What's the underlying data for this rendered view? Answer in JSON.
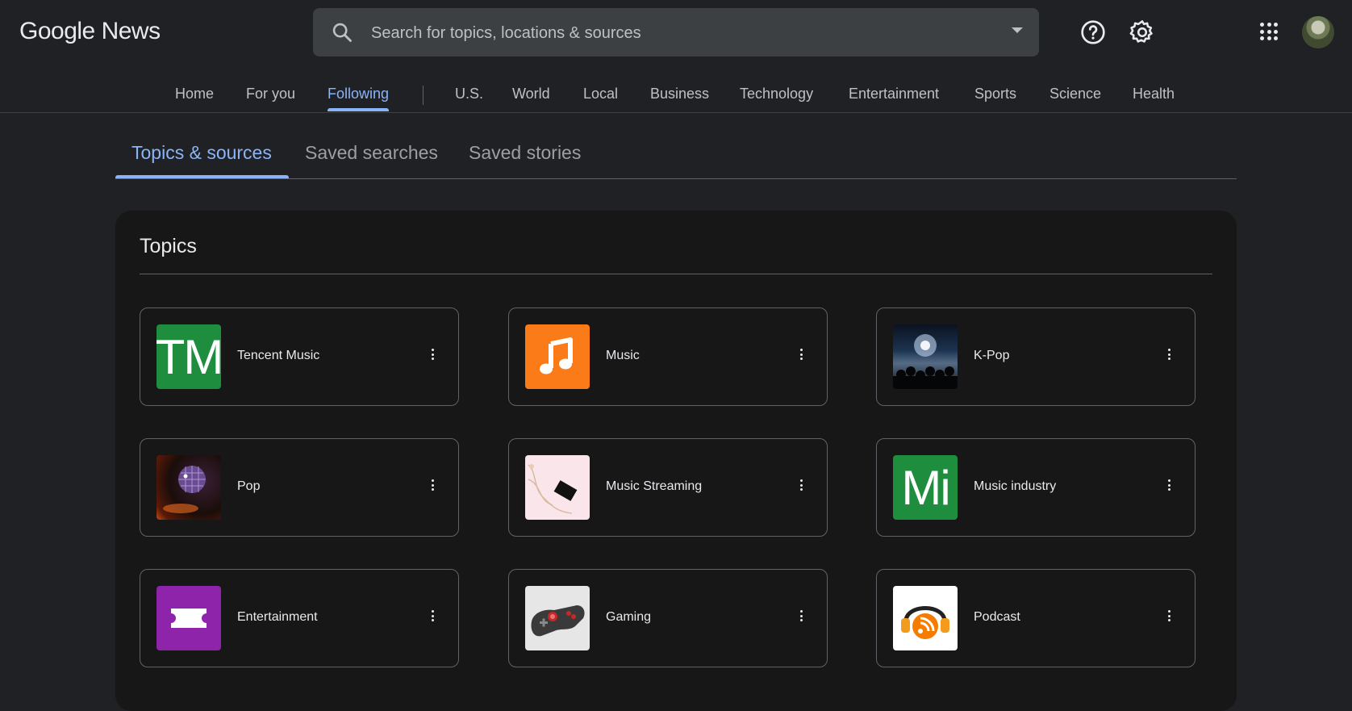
{
  "header": {
    "logo": "Google News",
    "search_placeholder": "Search for topics, locations & sources",
    "icons": [
      "search-icon",
      "dropdown-arrow-icon",
      "help-icon",
      "settings-icon",
      "apps-grid-icon",
      "account-avatar"
    ]
  },
  "nav": {
    "items": [
      "Home",
      "For you",
      "Following",
      "U.S.",
      "World",
      "Local",
      "Business",
      "Technology",
      "Entertainment",
      "Sports",
      "Science",
      "Health"
    ],
    "active": "Following"
  },
  "subtabs": {
    "items": [
      "Topics & sources",
      "Saved searches",
      "Saved stories"
    ],
    "active": "Topics & sources"
  },
  "topics": {
    "title": "Topics",
    "cards": [
      {
        "name": "Tencent Music",
        "thumb_text": "TM",
        "thumb_color": "#1e8e3e"
      },
      {
        "name": "Music",
        "thumb_icon": "music-note-icon",
        "thumb_color": "#fa7b17"
      },
      {
        "name": "K-Pop",
        "thumb_icon": "concert-photo"
      },
      {
        "name": "Pop",
        "thumb_icon": "disco-ball-photo"
      },
      {
        "name": "Music Streaming",
        "thumb_icon": "phone-earbuds-photo"
      },
      {
        "name": "Music industry",
        "thumb_text": "Mi",
        "thumb_color": "#1e8e3e"
      },
      {
        "name": "Entertainment",
        "thumb_icon": "ticket-icon",
        "thumb_color": "#8e24aa"
      },
      {
        "name": "Gaming",
        "thumb_icon": "gamepad-photo"
      },
      {
        "name": "Podcast",
        "thumb_icon": "podcast-icon"
      }
    ]
  },
  "colors": {
    "background": "#202124",
    "panel": "#171717",
    "accent": "#8ab4f8",
    "text": "#e8eaed",
    "muted": "#9aa0a6"
  }
}
